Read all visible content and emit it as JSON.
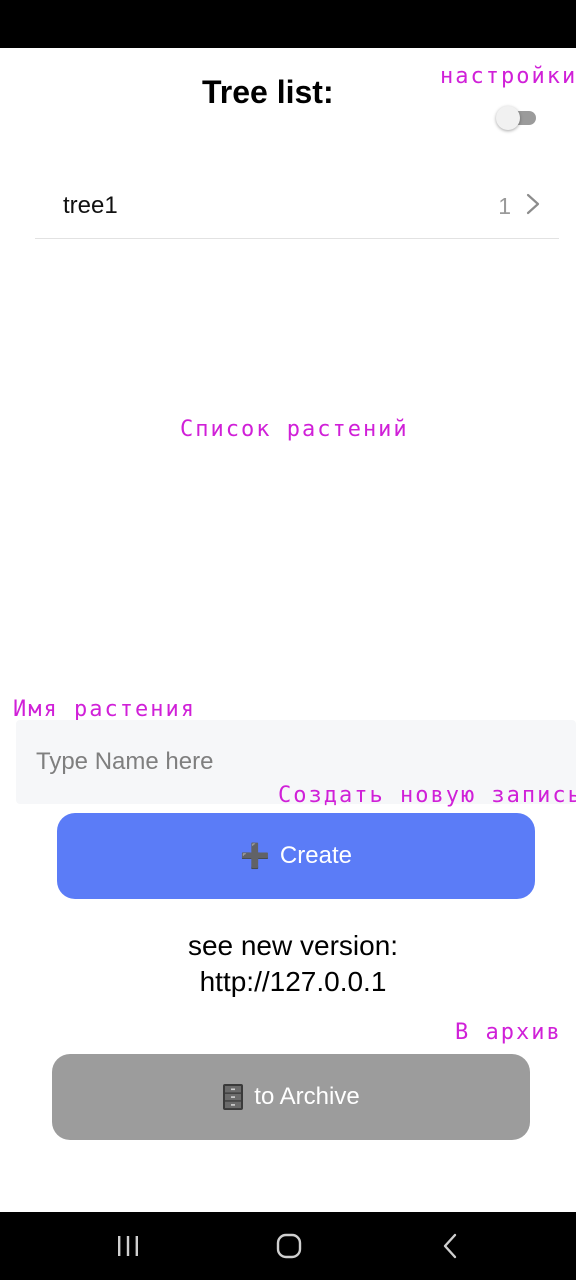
{
  "annotations": {
    "settings": "настройки",
    "plant_list": "Список растений",
    "plant_name": "Имя растения",
    "create_new": "Создать новую запись",
    "to_archive": "В архив"
  },
  "header": {
    "title": "Tree list:",
    "settings_toggle_on": false
  },
  "tree_list": {
    "items": [
      {
        "name": "tree1",
        "count": "1"
      }
    ]
  },
  "name_input": {
    "placeholder": "Type Name here",
    "value": ""
  },
  "create_button": {
    "icon": "plus-icon",
    "icon_glyph": "➕",
    "label": "Create"
  },
  "version_notice": {
    "line1": "see new version:",
    "line2": "http://127.0.0.1"
  },
  "archive_button": {
    "icon": "file-cabinet-icon",
    "label": "to Archive"
  },
  "colors": {
    "annotation": "#d020d8",
    "create_button": "#5b7cf7",
    "archive_button": "#9c9c9c",
    "input_background": "#f6f7f9"
  }
}
